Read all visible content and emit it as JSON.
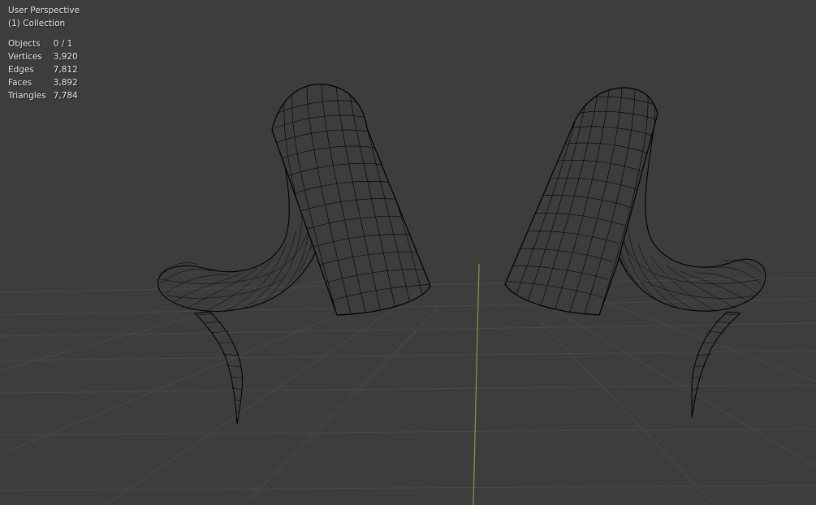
{
  "viewport": {
    "view_name": "User Perspective",
    "collection": "(1) Collection",
    "background_color": "#3d3d3d",
    "grid_color": "#4a4a4a",
    "y_axis_color": "#7ca33c",
    "wire_color": "#000000"
  },
  "stats": [
    {
      "label": "Objects",
      "value": "0 / 1"
    },
    {
      "label": "Vertices",
      "value": "3,920"
    },
    {
      "label": "Edges",
      "value": "7,812"
    },
    {
      "label": "Faces",
      "value": "3,892"
    },
    {
      "label": "Triangles",
      "value": "7,784"
    }
  ]
}
